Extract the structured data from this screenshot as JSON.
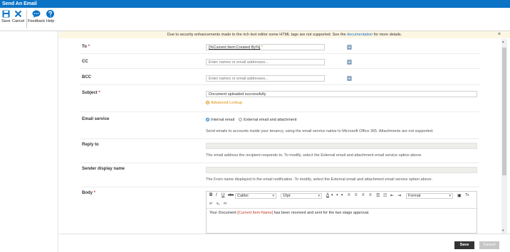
{
  "window": {
    "title": "Send An Email"
  },
  "ribbon": {
    "save": "Save",
    "cancel": "Cancel",
    "feedback": "Feedback",
    "help": "Help"
  },
  "banner": {
    "text_before": "Due to security enhancements made to the rich text editor some HTML tags are not supported. See the ",
    "link": "documentation",
    "text_after": " for more details.",
    "close": "×"
  },
  "form": {
    "to": {
      "label": "To",
      "required": "*",
      "token": "[%Current Item:Created By%]",
      "token_star": "*"
    },
    "cc": {
      "label": "CC",
      "placeholder": "Enter names or email addresses..."
    },
    "bcc": {
      "label": "BCC",
      "placeholder": "Enter names or email addresses..."
    },
    "subject": {
      "label": "Subject",
      "required": "*",
      "value": "Document uploaded successfully",
      "advanced": "Advanced Lookup"
    },
    "email_service": {
      "label": "Email service",
      "options": [
        "Internal email",
        "External email and attachment"
      ],
      "selected": "Internal email",
      "help": "Send emails to accounts inside your tenancy, using the email service native to Microsoft Office 365. Attachments are not supported."
    },
    "reply_to": {
      "label": "Reply to",
      "help": "The email address the recipient responds to. To modify, select the External email and attachment email service option above."
    },
    "sender": {
      "label": "Sender display name",
      "help": "The From name displayed in the email notification. To modify, select the External email and attachment email service option above."
    },
    "body": {
      "label": "Body",
      "required": "*",
      "font": "Calibri",
      "size": "10pt",
      "format": "Format",
      "text_before": "Your Document ",
      "ref": "[Current Item:Name]",
      "text_after": " has been received and sent for the two stage approval."
    }
  },
  "toolbar": {
    "bold": "B",
    "italic": "I",
    "underline": "U",
    "strike": "abc",
    "font_color": "A",
    "clear": "Tx",
    "subscript": "x₂",
    "superscript": "x²"
  },
  "footer": {
    "save": "Save",
    "cancel": "Cancel"
  },
  "colors": {
    "accent": "#0a73c6",
    "required": "#c0392b",
    "lookup": "#e08a00"
  }
}
